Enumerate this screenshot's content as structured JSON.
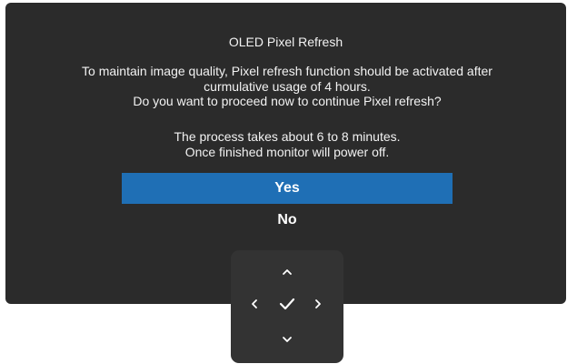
{
  "dialog": {
    "title": "OLED Pixel Refresh",
    "message_lines": [
      "To maintain image quality, Pixel refresh function should be activated after",
      "curmulative usage of 4 hours.",
      "Do you want to proceed now to continue Pixel refresh?"
    ],
    "note_lines": [
      "The process takes about 6 to 8 minutes.",
      "Once finished monitor will power off."
    ],
    "options": [
      {
        "label": "Yes",
        "selected": true
      },
      {
        "label": "No",
        "selected": false
      }
    ],
    "selected_color": "#1f6fb5",
    "panel_color": "#2b2b2b"
  },
  "joystick": {
    "buttons": [
      "chevron-up-icon",
      "chevron-left-icon",
      "checkmark-icon",
      "chevron-right-icon",
      "chevron-down-icon"
    ]
  }
}
